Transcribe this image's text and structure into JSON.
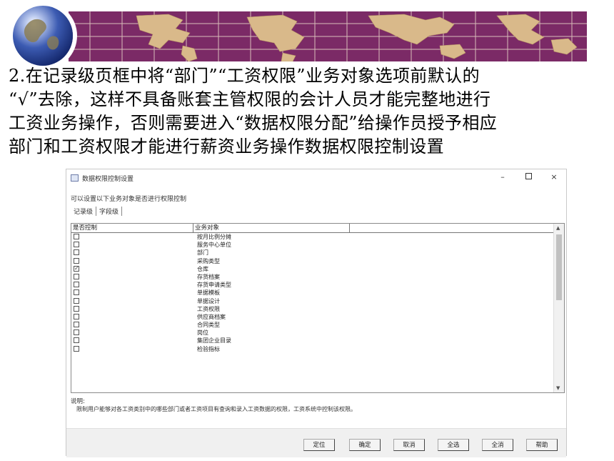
{
  "paragraph": {
    "lines": [
      "2.在记录级页框中将“部门”“工资权限”业务对象选项前默认的",
      "“√”去除，这样不具备账套主管权限的会计人员才能完整地进行",
      "工资业务操作，否则需要进入“数据权限分配”给操作员授予相应",
      "部门和工资权限才能进行薪资业务操作数据权限控制设置"
    ]
  },
  "dialog": {
    "title": "数据权限控制设置",
    "window_controls": {
      "minimize": "–",
      "close": "×"
    },
    "hint": "可以设置以下业务对象是否进行权限控制",
    "tabs": [
      "记录级",
      "字段级"
    ],
    "columns": [
      "是否控制",
      "业务对象"
    ],
    "rows": [
      {
        "checked": false,
        "object": "按月比例分摊"
      },
      {
        "checked": false,
        "object": "服务中心单位"
      },
      {
        "checked": false,
        "object": "部门"
      },
      {
        "checked": false,
        "object": "采购类型"
      },
      {
        "checked": true,
        "object": "仓库"
      },
      {
        "checked": false,
        "object": "存货档案"
      },
      {
        "checked": false,
        "object": "存货申请类型"
      },
      {
        "checked": false,
        "object": "单据模板"
      },
      {
        "checked": false,
        "object": "单据设计"
      },
      {
        "checked": false,
        "object": "工资权限"
      },
      {
        "checked": false,
        "object": "供应商档案"
      },
      {
        "checked": false,
        "object": "合同类型"
      },
      {
        "checked": false,
        "object": "岗位"
      },
      {
        "checked": false,
        "object": "集团企业目录"
      },
      {
        "checked": false,
        "object": "检验指标"
      }
    ],
    "check_mark": "✓",
    "scroll_up": "▲",
    "scroll_down": "▼",
    "note_label": "说明:",
    "note_text": "限制用户能够对各工资类别中的哪些部门或者工资项目有查询和录入工资数据的权限，工资系统中控制该权限。",
    "buttons": [
      "定位",
      "确定",
      "取消",
      "全选",
      "全消",
      "帮助"
    ]
  }
}
